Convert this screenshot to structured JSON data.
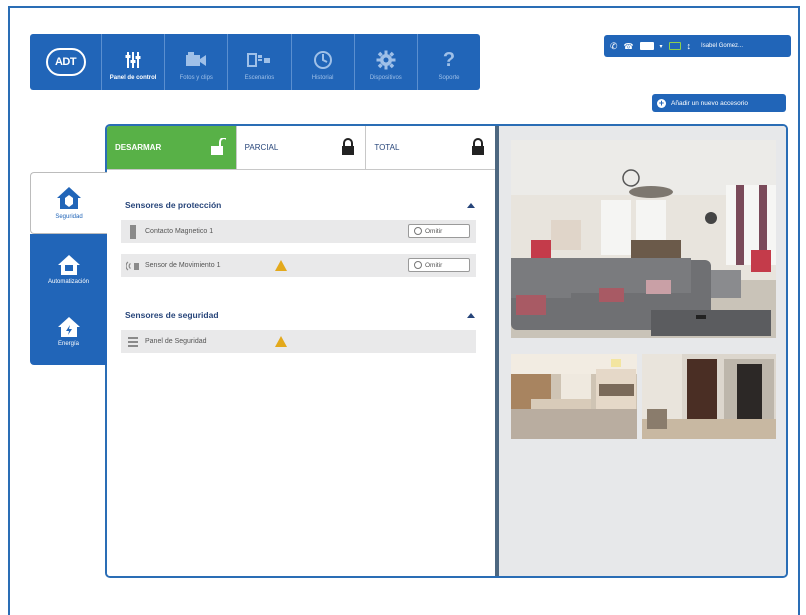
{
  "nav": {
    "logo": "ADT",
    "items": [
      {
        "label": "Panel de control",
        "icon": "sliders-icon",
        "active": true
      },
      {
        "label": "Fotos y clips",
        "icon": "camera-icon",
        "active": false
      },
      {
        "label": "Escenarios",
        "icon": "scenarios-icon",
        "active": false
      },
      {
        "label": "Historial",
        "icon": "clock-icon",
        "active": false
      },
      {
        "label": "Dispositivos",
        "icon": "gear-icon",
        "active": false
      },
      {
        "label": "Soporte",
        "icon": "question-icon",
        "active": false
      }
    ]
  },
  "topbar": {
    "user_label": "Isabel Gomez..."
  },
  "add_accessory": "Añadir un nuevo accesorio",
  "modes": [
    {
      "label": "DESARMAR",
      "icon": "unlock-icon",
      "active": true
    },
    {
      "label": "PARCIAL",
      "icon": "lock-icon",
      "active": false
    },
    {
      "label": "TOTAL",
      "icon": "lock-icon",
      "active": false
    }
  ],
  "side_tabs": [
    {
      "label": "Seguridad",
      "icon": "home-shield-icon",
      "active": true
    },
    {
      "label": "Automatización",
      "icon": "home-automation-icon",
      "active": false
    },
    {
      "label": "Energía",
      "icon": "home-energy-icon",
      "active": false
    }
  ],
  "sections": {
    "protection": {
      "title": "Sensores de protección",
      "rows": [
        {
          "name": "Contacto Magnetico 1",
          "icon": "door-contact-icon",
          "warning": false,
          "action": "Omitir"
        },
        {
          "name": "Sensor de Movimiento 1",
          "icon": "motion-sensor-icon",
          "warning": true,
          "action": "Omitir"
        }
      ]
    },
    "security": {
      "title": "Sensores de seguridad",
      "rows": [
        {
          "name": "Panel de Seguridad",
          "icon": "panel-icon",
          "warning": true
        }
      ]
    }
  },
  "colors": {
    "primary": "#2165b8",
    "active_mode": "#58b147",
    "warning": "#e3a91c",
    "text_dark": "#27457a"
  }
}
